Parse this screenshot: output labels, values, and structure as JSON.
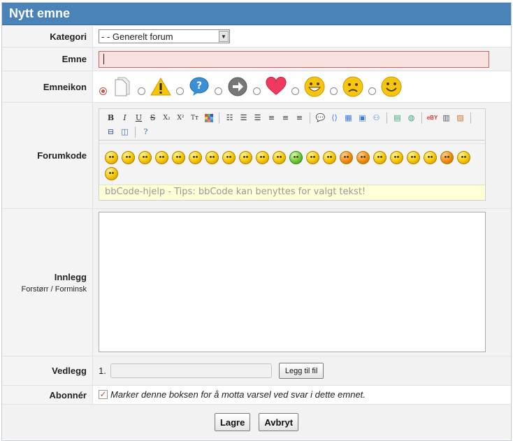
{
  "title": "Nytt emne",
  "kategori": {
    "label": "Kategori",
    "selected": "- - Generelt forum"
  },
  "emne": {
    "label": "Emne",
    "value": ""
  },
  "emneikon": {
    "label": "Emneikon",
    "icons": [
      "blank-page-icon",
      "warning-icon",
      "question-icon",
      "arrow-right-icon",
      "heart-icon",
      "grin-face-icon",
      "sad-face-icon",
      "smile-face-icon"
    ],
    "selected_index": 0
  },
  "forumkode": {
    "label": "Forumkode",
    "toolbar_row1": [
      "B",
      "I",
      "U",
      "S",
      "X₂",
      "X²",
      "Tт",
      "▦",
      "|",
      "list",
      "olist",
      "ulist",
      "|",
      "left",
      "center",
      "right",
      "|",
      "quote",
      "code",
      "table",
      "img",
      "gallery",
      "|",
      "flash",
      "web",
      "|",
      "ebay",
      "video",
      "map",
      "|"
    ],
    "toolbar_row2": [
      "hsplit",
      "vsplit",
      "|",
      "help"
    ],
    "smiley_count": 24,
    "help_text": "bbCode-hjelp - Tips: bbCode kan benyttes for valgt tekst!"
  },
  "innlegg": {
    "label": "Innlegg",
    "enlarge": "Forstørr",
    "separator": "/",
    "shrink": "Forminsk",
    "value": ""
  },
  "vedlegg": {
    "label": "Vedlegg",
    "index": "1.",
    "add_button": "Legg til fil"
  },
  "abonner": {
    "label": "Abonnér",
    "checked": true,
    "text": "Marker denne boksen for å motta varsel ved svar i dette emnet."
  },
  "actions": {
    "save": "Lagre",
    "cancel": "Avbryt"
  }
}
